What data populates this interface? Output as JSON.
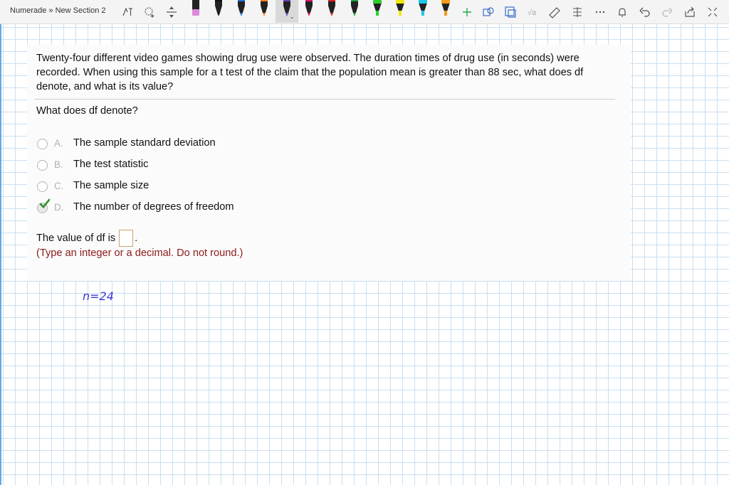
{
  "toolbar": {
    "breadcrumb": "Numerade » New Section 2",
    "pens": [
      {
        "icon": "pen-pink-icon",
        "color": "#d98ad9"
      },
      {
        "icon": "pen-black-icon",
        "color": "#111111"
      },
      {
        "icon": "pen-blue-icon",
        "color": "#1e6fd9"
      },
      {
        "icon": "pen-orange-icon",
        "color": "#f07b20"
      },
      {
        "icon": "pen-purple-icon",
        "color": "#6c3fb6"
      },
      {
        "icon": "pen-magenta-icon",
        "color": "#e0146e"
      },
      {
        "icon": "pen-red-icon",
        "color": "#e02020"
      },
      {
        "icon": "pen-green-icon",
        "color": "#1a9e3a"
      },
      {
        "icon": "highlighter-green-icon",
        "color": "#2bd12b"
      },
      {
        "icon": "highlighter-yellow-icon",
        "color": "#f2e600"
      },
      {
        "icon": "highlighter-cyan-icon",
        "color": "#1cc7e6"
      },
      {
        "icon": "highlighter-orange-icon",
        "color": "#f59a1a"
      }
    ]
  },
  "question": {
    "text": "Twenty-four different video games showing drug use were observed. The duration times of drug use (in seconds) were recorded. When using this sample for a t test of the claim that the population mean is greater than 88 sec, what does df denote, and what is its value?",
    "sub_question": "What does df denote?",
    "options": [
      {
        "letter": "A.",
        "text": "The sample standard deviation",
        "selected": false
      },
      {
        "letter": "B.",
        "text": "The test statistic",
        "selected": false
      },
      {
        "letter": "C.",
        "text": "The sample size",
        "selected": false
      },
      {
        "letter": "D.",
        "text": "The number of degrees of freedom",
        "selected": true
      }
    ],
    "df_prompt": "The value of df is",
    "df_value": "",
    "df_suffix": ".",
    "hint": "(Type an integer or a decimal. Do not round.)"
  },
  "annotation": {
    "handwritten": "n=24",
    "ink_color": "#3a3ad0"
  }
}
